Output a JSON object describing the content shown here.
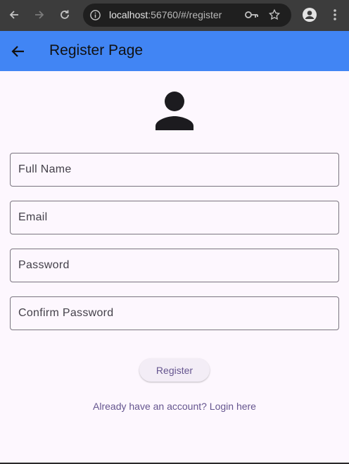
{
  "browser": {
    "url_host": "localhost",
    "url_rest": ":56760/#/register"
  },
  "appbar": {
    "title": "Register Page"
  },
  "form": {
    "full_name_placeholder": "Full Name",
    "email_placeholder": "Email",
    "password_placeholder": "Password",
    "confirm_password_placeholder": "Confirm Password",
    "register_label": "Register",
    "login_link_label": "Already have an account? Login here"
  },
  "colors": {
    "appbar": "#4185f4",
    "background": "#fdf7fe",
    "accent_text": "#65558f"
  },
  "icons": [
    "back-arrow-icon",
    "forward-arrow-icon",
    "reload-icon",
    "info-icon",
    "key-icon",
    "star-icon",
    "profile-icon",
    "more-vert-icon",
    "arrow-back-icon",
    "person-icon"
  ]
}
